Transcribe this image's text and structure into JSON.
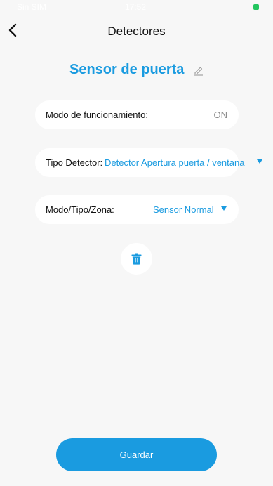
{
  "status_bar": {
    "carrier": "Sin SIM",
    "time": "17:52"
  },
  "header": {
    "title": "Detectores"
  },
  "device": {
    "name": "Sensor de puerta"
  },
  "settings": {
    "mode": {
      "label": "Modo de funcionamiento:",
      "value": "ON"
    },
    "detector_type": {
      "label": "Tipo Detector:",
      "value": "Detector Apertura puerta / ventana"
    },
    "zone_mode": {
      "label": "Modo/Tipo/Zona:",
      "value": "Sensor Normal"
    }
  },
  "footer": {
    "save_label": "Guardar"
  },
  "icons": {
    "back": "back-chevron-icon",
    "edit": "pencil-icon",
    "delete": "trash-icon",
    "dropdown": "caret-down-icon"
  },
  "colors": {
    "accent": "#1a9be0",
    "background": "#f7f7f7",
    "card": "#ffffff",
    "muted_text": "#8a8a8a"
  }
}
